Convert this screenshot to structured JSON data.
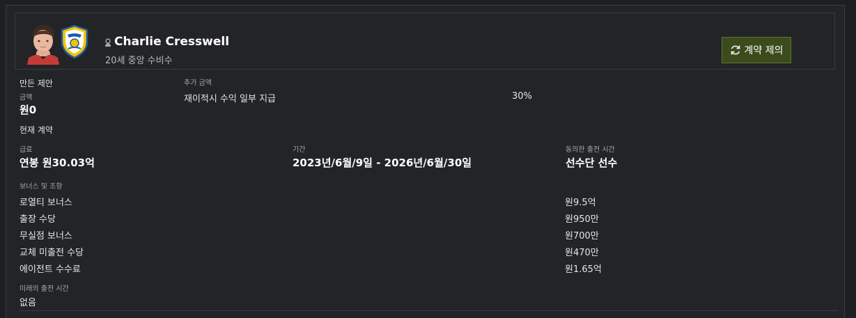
{
  "player": {
    "name": "Charlie Cresswell",
    "subtitle": "20세 중앙 수비수"
  },
  "actions": {
    "offer_contract": "계약 제의"
  },
  "offer": {
    "section_title": "만든 제안",
    "amount_label": "금액",
    "amount_value": "원0",
    "extra_label": "추가 금액",
    "extra_item": "재이적시 수익 일부 지급",
    "extra_value": "30%"
  },
  "contract": {
    "section_title": "현재 계약",
    "wage_label": "급료",
    "wage_value": "연봉 원30.03억",
    "period_label": "기간",
    "period_value": "2023년/6월/9일 - 2026년/6월/30일",
    "playing_time_label": "동의한 출전 시간",
    "playing_time_value": "선수단 선수",
    "bonuses_label": "보너스 및 조항",
    "bonuses": [
      {
        "name": "로열티 보너스",
        "value": "원9.5억"
      },
      {
        "name": "출장 수당",
        "value": "원950만"
      },
      {
        "name": "무실점 보너스",
        "value": "원700만"
      },
      {
        "name": "교체 미출전 수당",
        "value": "원470만"
      },
      {
        "name": "에이전트 수수료",
        "value": "원1.65억"
      }
    ],
    "future_time_label": "미래의 출전 시간",
    "future_time_value": "없음"
  },
  "colors": {
    "background": "#1e1f22",
    "panel": "#232427",
    "button_bg": "#3c4b1c",
    "button_border": "#5f7330",
    "crest_yellow": "#f2c400",
    "crest_blue": "#1d5ba8"
  }
}
